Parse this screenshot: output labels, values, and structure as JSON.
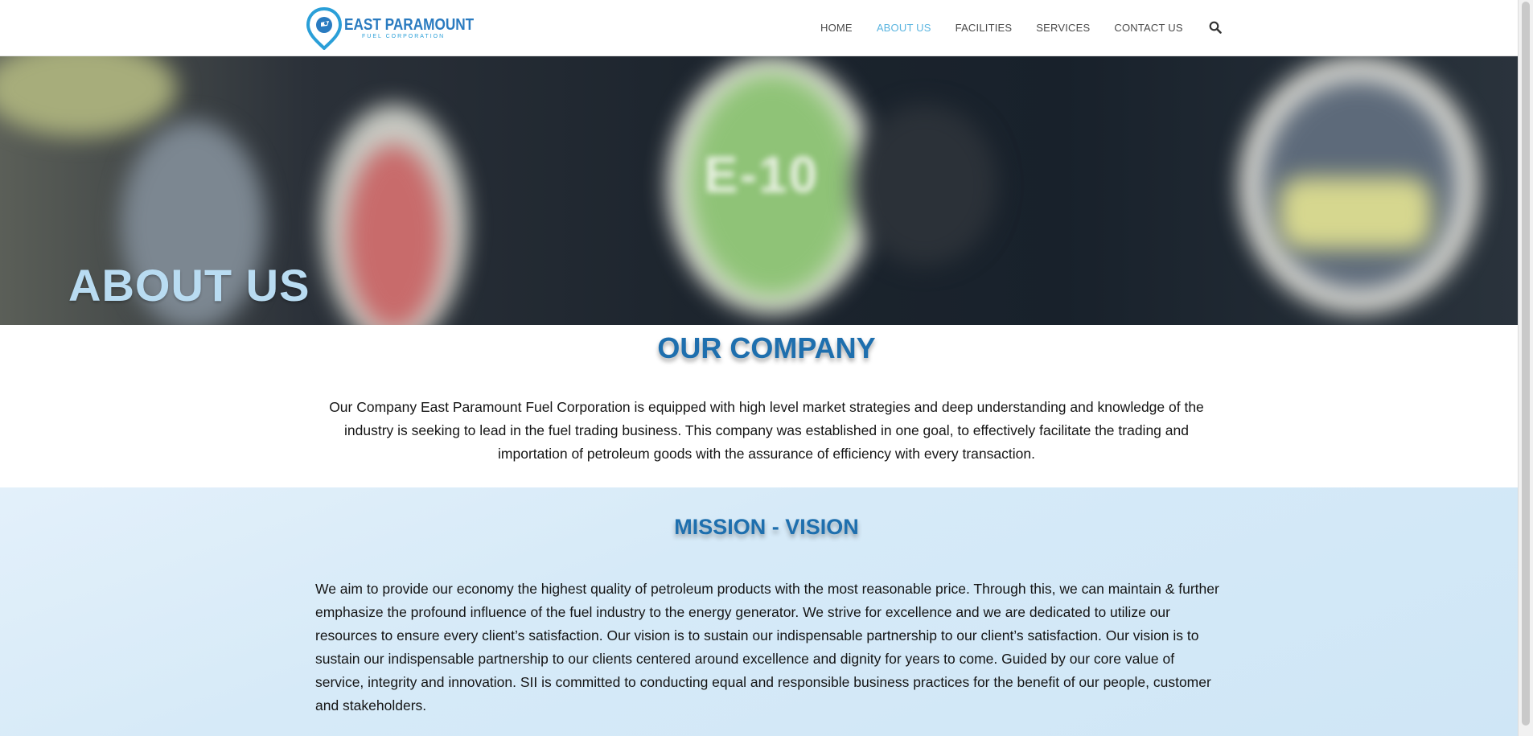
{
  "header": {
    "brand": "EAST PARAMOUNT",
    "brand_sub": "FUEL CORPORATION",
    "nav": [
      {
        "label": "HOME",
        "active": false
      },
      {
        "label": "ABOUT US",
        "active": true
      },
      {
        "label": "FACILITIES",
        "active": false
      },
      {
        "label": "SERVICES",
        "active": false
      },
      {
        "label": "CONTACT US",
        "active": false
      }
    ],
    "search_icon": "search-icon"
  },
  "hero": {
    "title": "ABOUT US",
    "pump_label": "E-10"
  },
  "company": {
    "heading": "OUR COMPANY",
    "body": "Our Company East Paramount Fuel Corporation is equipped with high level market strategies and deep understanding and knowledge of the industry is seeking to lead in the fuel trading business. This company was established in one goal, to effectively facilitate the trading and importation of petroleum goods with the assurance of efficiency with every transaction."
  },
  "mission": {
    "heading": "MISSION - VISION",
    "body": "We aim to provide our economy the highest quality of petroleum products with the most reasonable price. Through this, we can maintain & further emphasize the profound influence of the fuel industry to the energy generator. We strive for excellence and we are dedicated to utilize our resources to ensure every client’s satisfaction. Our vision is to sustain our indispensable partnership to our client’s satisfaction. Our vision is to sustain our indispensable partnership to our clients centered around excellence and dignity for years to come. Guided by our core value of service, integrity and innovation. SII is committed to conducting equal and responsible business practices for the benefit of our people, customer and stakeholders."
  },
  "colors": {
    "accent": "#1e6fae",
    "nav_active": "#5bb5e0",
    "hero_title": "#b9dcf2",
    "mission_bg": "#d6eaf8"
  }
}
